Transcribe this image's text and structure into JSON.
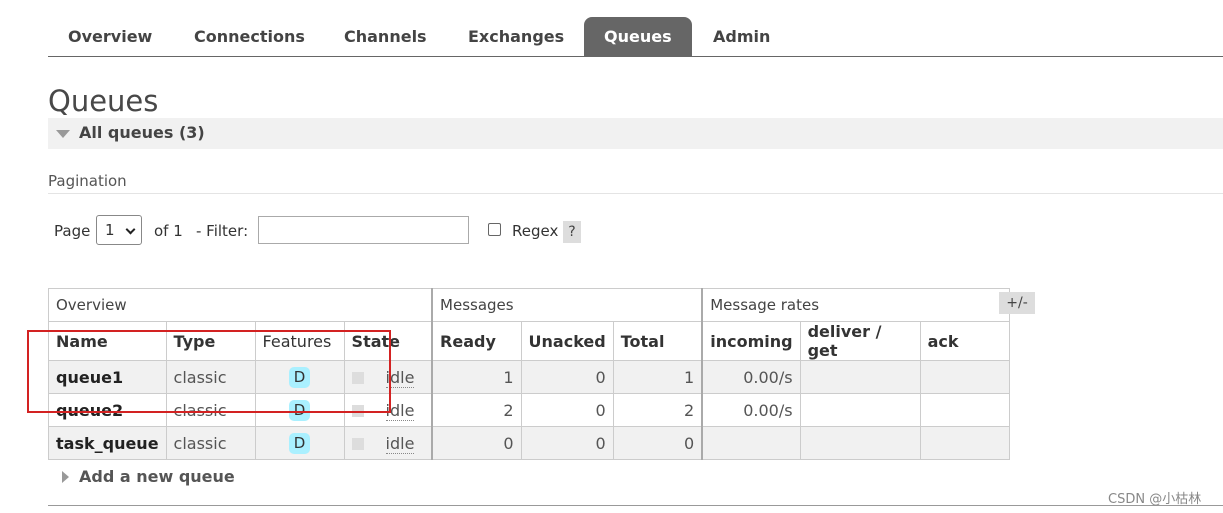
{
  "nav": {
    "tabs": [
      {
        "label": "Overview",
        "active": false
      },
      {
        "label": "Connections",
        "active": false
      },
      {
        "label": "Channels",
        "active": false
      },
      {
        "label": "Exchanges",
        "active": false
      },
      {
        "label": "Queues",
        "active": true
      },
      {
        "label": "Admin",
        "active": false
      }
    ]
  },
  "page": {
    "title": "Queues",
    "section_title": "All queues (3)",
    "pagination_label": "Pagination",
    "add_queue_label": "Add a new queue"
  },
  "pager": {
    "page_label": "Page",
    "page_value": "1",
    "of_label": "of 1",
    "filter_label": "- Filter:",
    "filter_value": "",
    "regex_label": "Regex",
    "regex_checked": false,
    "help_label": "?"
  },
  "table": {
    "groups": [
      "Overview",
      "Messages",
      "Message rates"
    ],
    "toggle_columns_label": "+/-",
    "headers": [
      "Name",
      "Type",
      "Features",
      "State",
      "Ready",
      "Unacked",
      "Total",
      "incoming",
      "deliver / get",
      "ack"
    ],
    "rows": [
      {
        "name": "queue1",
        "type": "classic",
        "feature": "D",
        "state": "idle",
        "ready": "1",
        "unacked": "0",
        "total": "1",
        "incoming": "0.00/s",
        "deliver_get": "",
        "ack": ""
      },
      {
        "name": "queue2",
        "type": "classic",
        "feature": "D",
        "state": "idle",
        "ready": "2",
        "unacked": "0",
        "total": "2",
        "incoming": "0.00/s",
        "deliver_get": "",
        "ack": ""
      },
      {
        "name": "task_queue",
        "type": "classic",
        "feature": "D",
        "state": "idle",
        "ready": "0",
        "unacked": "0",
        "total": "0",
        "incoming": "",
        "deliver_get": "",
        "ack": ""
      }
    ]
  },
  "watermark": "CSDN @小枯林",
  "colors": {
    "active_tab": "#666666",
    "badge": "#aaf0ff",
    "highlight_box": "#d32222"
  }
}
